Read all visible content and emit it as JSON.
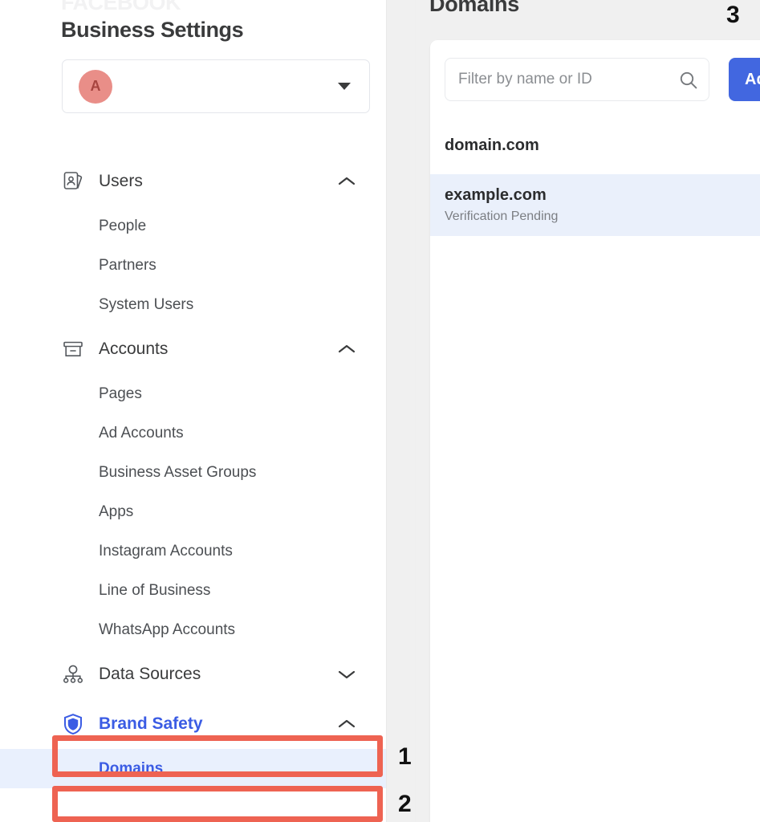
{
  "sidebar": {
    "brand_wordmark": "FACEBOOK",
    "page_title": "Business Settings",
    "business_selector": {
      "avatar_letter": "A",
      "avatar_color": "#e98e88",
      "caret_icon": "chevron-down-icon"
    },
    "groups": [
      {
        "label": "Users",
        "icon": "id-card-icon",
        "expanded": true,
        "chevron": "chevron-up-icon",
        "items": [
          {
            "label": "People"
          },
          {
            "label": "Partners"
          },
          {
            "label": "System Users"
          }
        ]
      },
      {
        "label": "Accounts",
        "icon": "archive-box-icon",
        "expanded": true,
        "chevron": "chevron-up-icon",
        "items": [
          {
            "label": "Pages"
          },
          {
            "label": "Ad Accounts"
          },
          {
            "label": "Business Asset Groups"
          },
          {
            "label": "Apps"
          },
          {
            "label": "Instagram Accounts"
          },
          {
            "label": "Line of Business"
          },
          {
            "label": "WhatsApp Accounts"
          }
        ]
      },
      {
        "label": "Data Sources",
        "icon": "network-nodes-icon",
        "expanded": false,
        "chevron": "chevron-down-icon",
        "items": []
      },
      {
        "label": "Brand Safety",
        "icon": "shield-icon",
        "expanded": true,
        "chevron": "chevron-up-icon",
        "active": true,
        "items": [
          {
            "label": "Domains",
            "active": true
          }
        ]
      }
    ]
  },
  "main": {
    "heading": "Domains",
    "search": {
      "placeholder": "Filter by name or ID",
      "value": "",
      "icon": "search-icon"
    },
    "add_button_label": "Add",
    "domains": [
      {
        "name": "domain.com",
        "status": "",
        "selected": false
      },
      {
        "name": "example.com",
        "status": "Verification Pending",
        "selected": true
      }
    ]
  },
  "annotations": {
    "accent_color": "#ee6352",
    "markers": [
      {
        "number": "1",
        "target": "Brand Safety"
      },
      {
        "number": "2",
        "target": "Domains"
      },
      {
        "number": "3",
        "target": "Add"
      }
    ]
  },
  "colors": {
    "accent_blue": "#3b5ce4",
    "button_blue": "#4267e0",
    "selected_row": "#eaf0fb",
    "annotation_red": "#ee6352",
    "avatar": "#e98e88"
  }
}
